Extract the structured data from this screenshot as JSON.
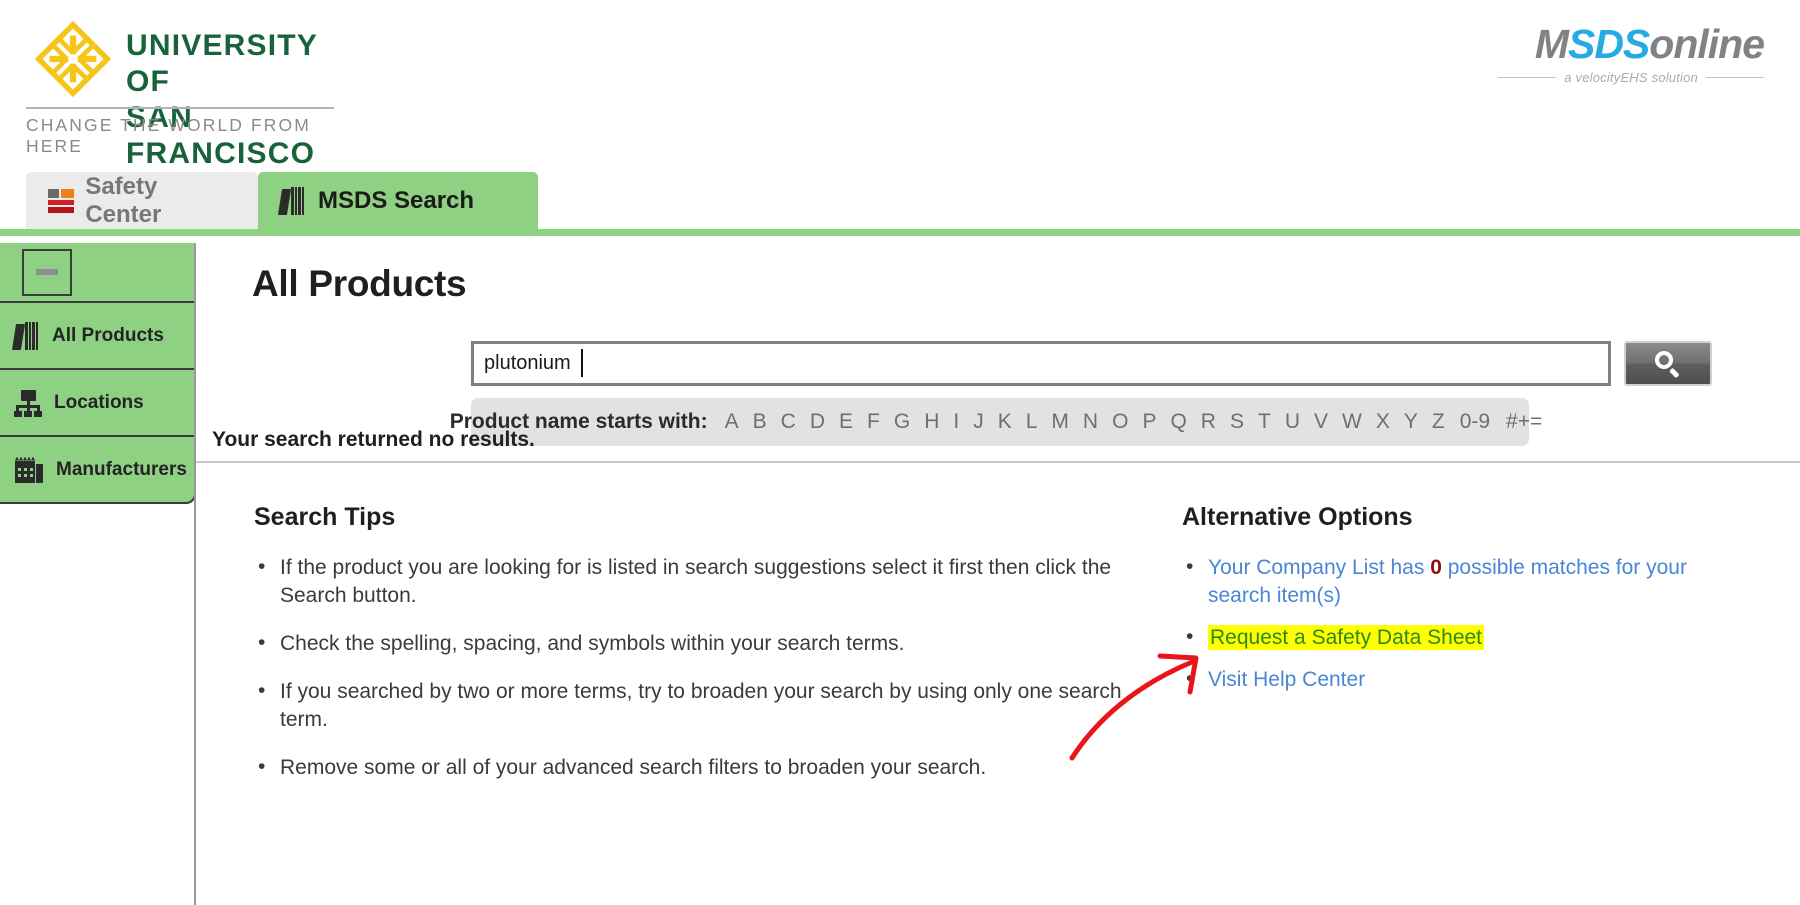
{
  "header": {
    "university": {
      "line1": "UNIVERSITY OF",
      "line2": "SAN FRANCISCO",
      "tagline": "CHANGE THE WORLD FROM HERE",
      "mark_color": "#f5c518",
      "text_color": "#19633c"
    },
    "vendor": {
      "name_part1": "MSDS",
      "name_part2": "online",
      "name_part1_prefix": "M",
      "name_part1_mid": "SDS",
      "tagline": "a velocityEHS solution",
      "gray": "#808285",
      "cyan": "#27aae1"
    }
  },
  "tabs": [
    {
      "id": "safety-center",
      "label": "Safety Center",
      "icon": "safety-center-icon",
      "active": false
    },
    {
      "id": "msds-search",
      "label": "MSDS Search",
      "icon": "books-icon",
      "active": true
    }
  ],
  "sidebar": {
    "collapse_label": "",
    "items": [
      {
        "id": "all-products",
        "label": "All Products",
        "icon": "books-icon"
      },
      {
        "id": "locations",
        "label": "Locations",
        "icon": "org-chart-icon"
      },
      {
        "id": "manufacturers",
        "label": "Manufacturers",
        "icon": "factory-icon"
      }
    ]
  },
  "main": {
    "title": "All Products",
    "search": {
      "value": "plutonium",
      "placeholder": "",
      "button_icon": "search-icon"
    },
    "alpha_filter": {
      "label": "Product name starts with:",
      "letters": [
        "A",
        "B",
        "C",
        "D",
        "E",
        "F",
        "G",
        "H",
        "I",
        "J",
        "K",
        "L",
        "M",
        "N",
        "O",
        "P",
        "Q",
        "R",
        "S",
        "T",
        "U",
        "V",
        "W",
        "X",
        "Y",
        "Z",
        "0-9",
        "#+="
      ]
    },
    "result_message": "Your search returned no results.",
    "search_tips": {
      "heading": "Search Tips",
      "items": [
        "If the product you are looking for is listed in search suggestions select it first then click the Search button.",
        "Check the spelling, spacing, and symbols within your search terms.",
        "If you searched by two or more terms, try to broaden your search by using only one search term.",
        "Remove some or all of your advanced search filters to broaden your search."
      ]
    },
    "alternative_options": {
      "heading": "Alternative Options",
      "company_list": {
        "text_before": "Your Company List has ",
        "count": "0",
        "text_after": " possible matches for your search item(s)"
      },
      "request_sds": "Request a Safety Data Sheet",
      "help_center": "Visit Help Center"
    }
  },
  "colors": {
    "accent_green": "#8fd183",
    "link_blue": "#4a86d6",
    "highlight_yellow": "#ffff00",
    "highlight_text_green": "#2b8a1e",
    "annotation_red": "#e8161a",
    "count_red": "#8a1010"
  },
  "annotation": {
    "type": "arrow",
    "color": "#e8161a",
    "points_to": "request-sds-link"
  }
}
